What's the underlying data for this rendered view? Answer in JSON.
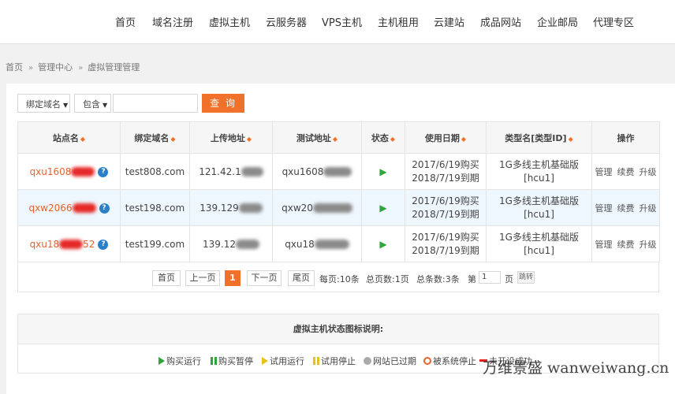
{
  "nav": [
    "首页",
    "域名注册",
    "虚拟主机",
    "云服务器",
    "VPS主机",
    "主机租用",
    "云建站",
    "成品网站",
    "企业邮局",
    "代理专区"
  ],
  "breadcrumb": [
    "首页",
    "管理中心",
    "虚拟管理管理"
  ],
  "search": {
    "field_select": "绑定域名",
    "match_select": "包含",
    "input_value": "",
    "button_label": "查 询"
  },
  "table": {
    "headers": [
      "站点名",
      "绑定域名",
      "上传地址",
      "测试地址",
      "状态",
      "使用日期",
      "类型名[类型ID]",
      "操作"
    ],
    "rows": [
      {
        "site": "qxu1608",
        "site_tail": "",
        "domain": "test808.com",
        "upload": "121.42.1",
        "test": "qxu1608",
        "buy": "2017/6/19购买",
        "expire": "2018/7/19到期",
        "type": "1G多线主机基础版",
        "type_id": "[hcu1]"
      },
      {
        "site": "qxw2066",
        "site_tail": "",
        "domain": "test198.com",
        "upload": "139.129",
        "test": "qxw20",
        "buy": "2017/6/19购买",
        "expire": "2018/7/19到期",
        "type": "1G多线主机基础版",
        "type_id": "[hcu1]"
      },
      {
        "site": "qxu18",
        "site_tail": "52",
        "domain": "test199.com",
        "upload": "139.12",
        "test": "qxu18",
        "buy": "2017/6/19购买",
        "expire": "2018/7/19到期",
        "type": "1G多线主机基础版",
        "type_id": "[hcu1]"
      }
    ],
    "ops": [
      "管理",
      "续费",
      "升级"
    ]
  },
  "pager": {
    "first": "首页",
    "prev": "上一页",
    "current": "1",
    "next": "下一页",
    "last": "尾页",
    "per_page": "每页:10条",
    "total_pages": "总页数:1页",
    "total_items": "总条数:3条",
    "goto_prefix": "第",
    "goto_value": "1",
    "goto_suffix": "页",
    "jump": "跳转"
  },
  "legend": {
    "title": "虚拟主机状态图标说明:",
    "items": [
      "购买运行",
      "购买暂停",
      "试用运行",
      "试用停止",
      "网站已过期",
      "被系统停止",
      "未开设成功"
    ]
  },
  "watermark": "万维景盛 wanweiwang.cn",
  "colors": {
    "accent": "#f0722a",
    "link": "#e8622a",
    "running": "#2ea63b",
    "info": "#2a7fc9",
    "alt_row": "#eef7fd"
  }
}
